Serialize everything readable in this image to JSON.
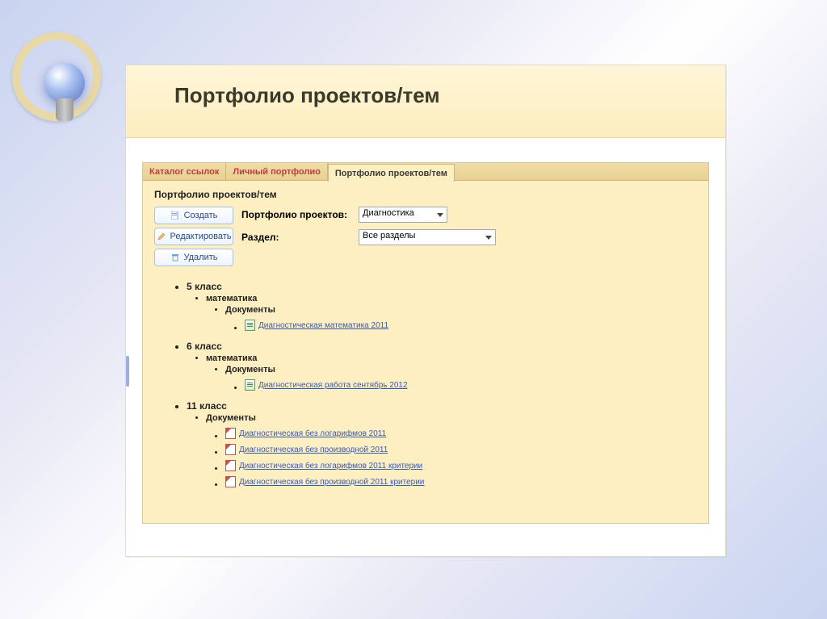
{
  "slide": {
    "title": "Портфолио проектов/тем"
  },
  "tabs": {
    "catalog": "Каталог ссылок",
    "personal": "Личный портфолио",
    "projects": "Портфолио проектов/тем"
  },
  "section": {
    "heading": "Портфолио проектов/тем"
  },
  "actions": {
    "create": "Создать",
    "edit": "Редактировать",
    "delete": "Удалить"
  },
  "filters": {
    "project_label": "Портфолио проектов:",
    "project_value": "Диагностика",
    "section_label": "Раздел:",
    "section_value": "Все разделы"
  },
  "tree": {
    "g5": {
      "label": "5 класс",
      "subj": "математика",
      "docs_label": "Документы",
      "docs": {
        "d1": "Диагностическая математика 2011"
      }
    },
    "g6": {
      "label": "6 класс",
      "subj": "математика",
      "docs_label": "Документы",
      "docs": {
        "d1": "Диагностическая работа сентябрь 2012"
      }
    },
    "g11": {
      "label": "11 класс",
      "docs_label": "Документы",
      "docs": {
        "d1": "Диагностическая без логарифмов 2011",
        "d2": "Диагностическая без производной 2011",
        "d3": "Диагностическая без логарифмов 2011 критерии",
        "d4": "Диагностическая без производной 2011 критерии"
      }
    }
  }
}
